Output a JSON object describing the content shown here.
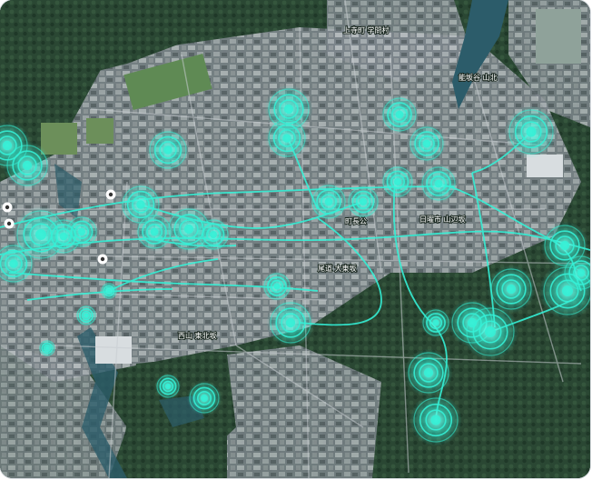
{
  "map": {
    "accent_color": "#35f0d6",
    "forest_color": "#26402f",
    "urban_color": "#8a9297",
    "water_color": "#2c5c6a",
    "field_color": "#5f8a54",
    "labels": [
      {
        "id": "north-top",
        "text": "上寺町 学問村"
      },
      {
        "id": "north-right",
        "text": "能坂谷 山北"
      },
      {
        "id": "center",
        "text": "町長公"
      },
      {
        "id": "east",
        "text": "日曜市 山辺坂"
      },
      {
        "id": "center-south",
        "text": "尾道 大東坂"
      },
      {
        "id": "south-west",
        "text": "西山 東北坂"
      }
    ],
    "pins": [
      {
        "id": "pin-1"
      },
      {
        "id": "pin-2"
      },
      {
        "id": "pin-3"
      },
      {
        "id": "pin-4"
      }
    ]
  }
}
